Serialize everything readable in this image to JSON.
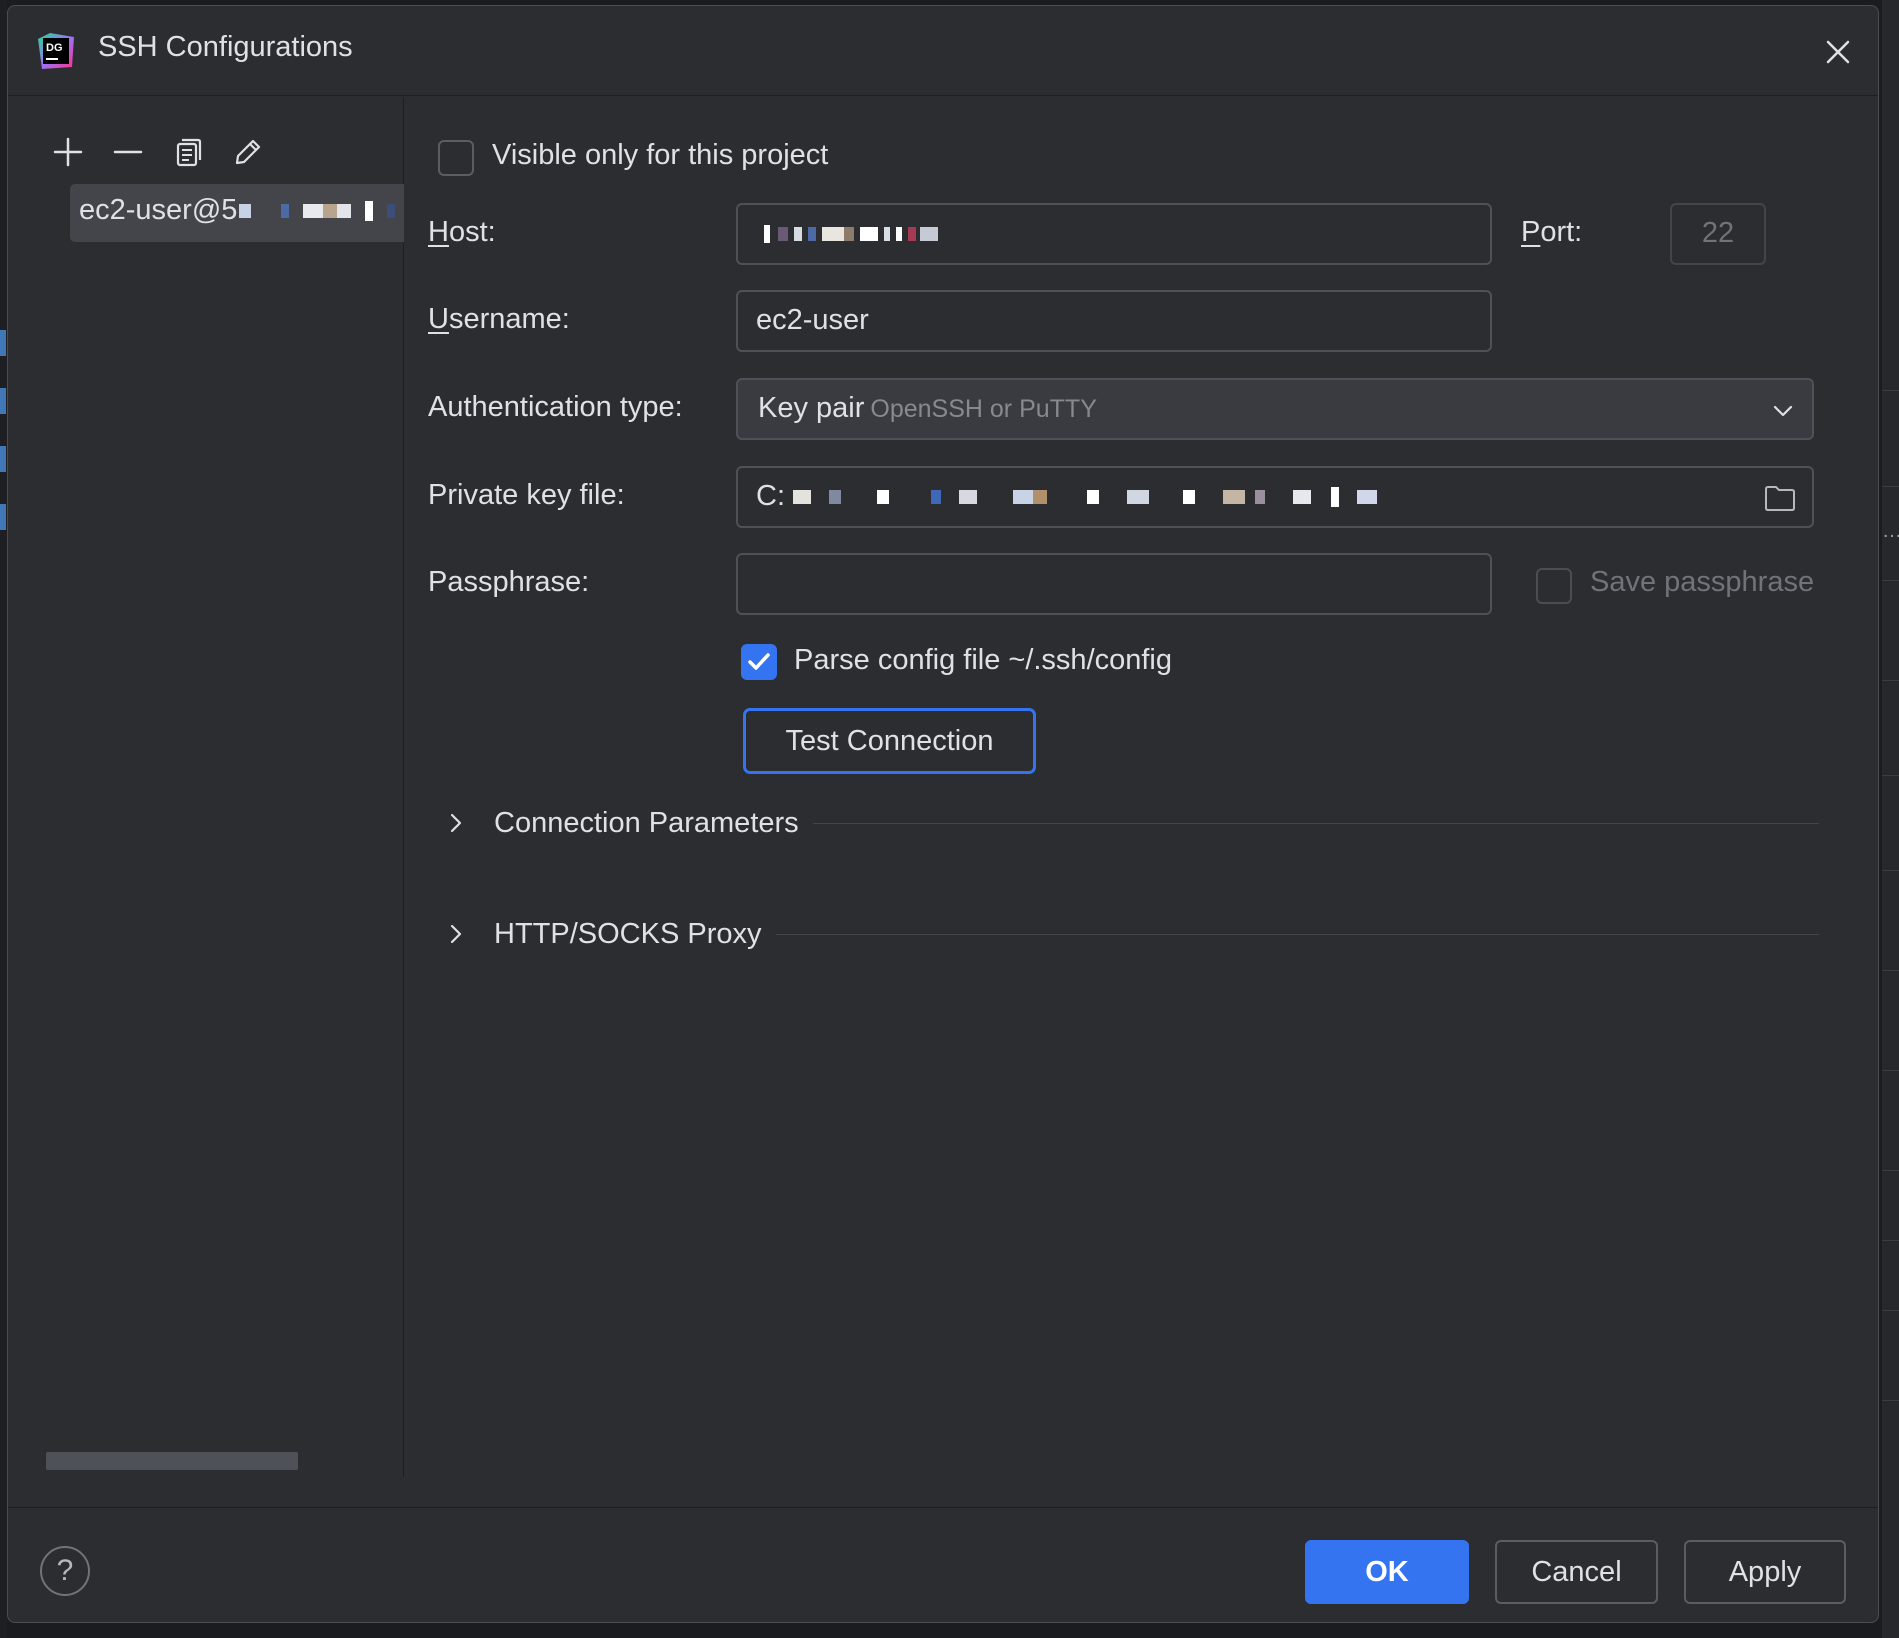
{
  "window": {
    "title": "SSH Configurations",
    "app_icon_text": "DG"
  },
  "sidebar": {
    "toolbar": {
      "add_icon": "plus-icon",
      "remove_icon": "minus-icon",
      "copy_icon": "copy-icon",
      "edit_icon": "pencil-icon"
    },
    "items": [
      {
        "label": "ec2-user@5"
      }
    ]
  },
  "form": {
    "visible_only_label": "Visible only for this project",
    "visible_only_checked": false,
    "host_label": "Host:",
    "host_value": "",
    "port_label": "Port:",
    "port_value": "22",
    "username_label": "Username:",
    "username_value": "ec2-user",
    "auth_type_label": "Authentication type:",
    "auth_type_value": "Key pair",
    "auth_type_hint": "OpenSSH or PuTTY",
    "private_key_label": "Private key file:",
    "private_key_value": "C:",
    "passphrase_label": "Passphrase:",
    "passphrase_value": "",
    "save_passphrase_label": "Save passphrase",
    "save_passphrase_checked": false,
    "parse_config_label": "Parse config file ~/.ssh/config",
    "parse_config_checked": true,
    "test_connection_label": "Test Connection"
  },
  "sections": [
    {
      "label": "Connection Parameters",
      "expanded": false
    },
    {
      "label": "HTTP/SOCKS Proxy",
      "expanded": false
    }
  ],
  "footer": {
    "help_label": "?",
    "ok_label": "OK",
    "cancel_label": "Cancel",
    "apply_label": "Apply"
  },
  "colors": {
    "accent": "#3574f0",
    "background": "#2b2d30",
    "text": "#dfe1e5"
  }
}
